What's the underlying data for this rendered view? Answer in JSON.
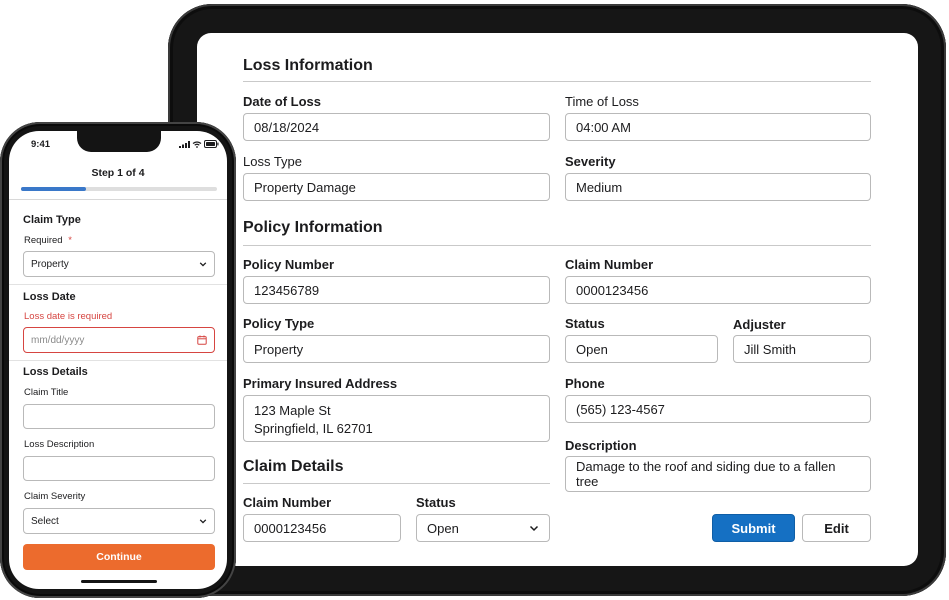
{
  "phone": {
    "status_time": "9:41",
    "step_label": "Step 1 of 4",
    "progress": 0.33,
    "claim_type": {
      "title": "Claim Type",
      "required_label": "Required",
      "required_marker": "*",
      "selected": "Property"
    },
    "loss_date": {
      "title": "Loss Date",
      "error": "Loss date is required",
      "placeholder": "mm/dd/yyyy"
    },
    "loss_details": {
      "title": "Loss Details",
      "claim_title_label": "Claim Title",
      "loss_description_label": "Loss Description",
      "claim_severity_label": "Claim Severity",
      "claim_severity_selected": "Select"
    },
    "continue_label": "Continue"
  },
  "tablet": {
    "loss_information": {
      "title": "Loss Information",
      "date_of_loss_label": "Date of Loss",
      "date_of_loss": "08/18/2024",
      "time_of_loss_label": "Time of Loss",
      "time_of_loss": "04:00 AM",
      "loss_type_label": "Loss Type",
      "loss_type": "Property Damage",
      "severity_label": "Severity",
      "severity": "Medium"
    },
    "policy_information": {
      "title": "Policy Information",
      "policy_number_label": "Policy Number",
      "policy_number": "123456789",
      "claim_number_label": "Claim Number",
      "claim_number": "0000123456",
      "policy_type_label": "Policy Type",
      "policy_type": "Property",
      "status_label": "Status",
      "status": "Open",
      "adjuster_label": "Adjuster",
      "adjuster": "Jill Smith",
      "address_label": "Primary Insured Address",
      "address_line1": "123 Maple St",
      "address_line2": "Springfield, IL 62701",
      "phone_label": "Phone",
      "phone": "(565) 123-4567",
      "description_label": "Description",
      "description": "Damage to the roof and siding due to a fallen tree"
    },
    "claim_details": {
      "title": "Claim Details",
      "claim_number_label": "Claim Number",
      "claim_number": "0000123456",
      "status_label": "Status",
      "status": "Open"
    },
    "submit_label": "Submit",
    "edit_label": "Edit"
  },
  "colors": {
    "primary_button": "#1570c3",
    "progress_fill": "#3a78c9",
    "continue_button": "#ec6b2d",
    "error": "#d64541"
  },
  "icons": [
    "chevron-down-icon",
    "calendar-icon",
    "signal-icon",
    "wifi-icon",
    "battery-icon"
  ]
}
